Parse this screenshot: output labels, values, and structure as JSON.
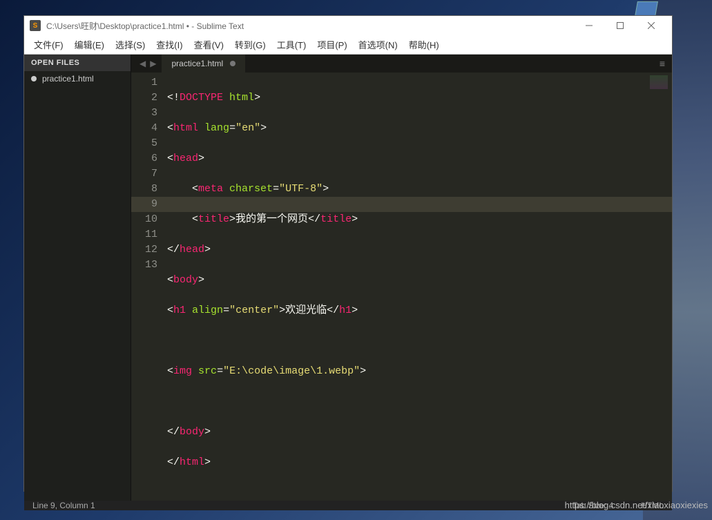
{
  "titlebar": {
    "path": "C:\\Users\\旺财\\Desktop\\practice1.html • - Sublime Text"
  },
  "menu": {
    "file": "文件(F)",
    "edit": "编辑(E)",
    "select": "选择(S)",
    "find": "查找(I)",
    "view": "查看(V)",
    "goto": "转到(G)",
    "tools": "工具(T)",
    "project": "项目(P)",
    "preferences": "首选项(N)",
    "help": "帮助(H)"
  },
  "sidebar": {
    "header": "OPEN FILES",
    "files": [
      "practice1.html"
    ]
  },
  "tabbar": {
    "tab1": "practice1.html"
  },
  "gutter": {
    "l1": "1",
    "l2": "2",
    "l3": "3",
    "l4": "4",
    "l5": "5",
    "l6": "6",
    "l7": "7",
    "l8": "8",
    "l9": "9",
    "l10": "10",
    "l11": "11",
    "l12": "12",
    "l13": "13"
  },
  "code": {
    "l1": {
      "t1": "<!",
      "t2": "DOCTYPE",
      "t3": " ",
      "t4": "html",
      "t5": ">"
    },
    "l2": {
      "t1": "<",
      "t2": "html",
      "t3": " ",
      "t4": "lang",
      "t5": "=",
      "t6": "\"en\"",
      "t7": ">"
    },
    "l3": {
      "t1": "<",
      "t2": "head",
      "t3": ">"
    },
    "l4": {
      "t1": "    <",
      "t2": "meta",
      "t3": " ",
      "t4": "charset",
      "t5": "=",
      "t6": "\"UTF-8\"",
      "t7": ">"
    },
    "l5": {
      "t1": "    <",
      "t2": "title",
      "t3": ">",
      "t4": "我的第一个网页",
      "t5": "</",
      "t6": "title",
      "t7": ">"
    },
    "l6": {
      "t1": "</",
      "t2": "head",
      "t3": ">"
    },
    "l7": {
      "t1": "<",
      "t2": "body",
      "t3": ">"
    },
    "l8": {
      "t1": "<",
      "t2": "h1",
      "t3": " ",
      "t4": "align",
      "t5": "=",
      "t6": "\"center\"",
      "t7": ">",
      "t8": "欢迎光临",
      "t9": "</",
      "t10": "h1",
      "t11": ">"
    },
    "l9": {
      "t1": ""
    },
    "l10": {
      "t1": "<",
      "t2": "img",
      "t3": " ",
      "t4": "src",
      "t5": "=",
      "t6": "\"E:\\code\\image\\1.webp\"",
      "t7": ">"
    },
    "l11": {
      "t1": ""
    },
    "l12": {
      "t1": "</",
      "t2": "body",
      "t3": ">"
    },
    "l13": {
      "t1": "</",
      "t2": "html",
      "t3": ">"
    }
  },
  "statusbar": {
    "cursor": "Line 9, Column 1",
    "tabsize": "Tab Size: 4",
    "syntax": "HTML"
  },
  "watermark": "https://blog.csdn.net/xiaoxiaoxiexies"
}
